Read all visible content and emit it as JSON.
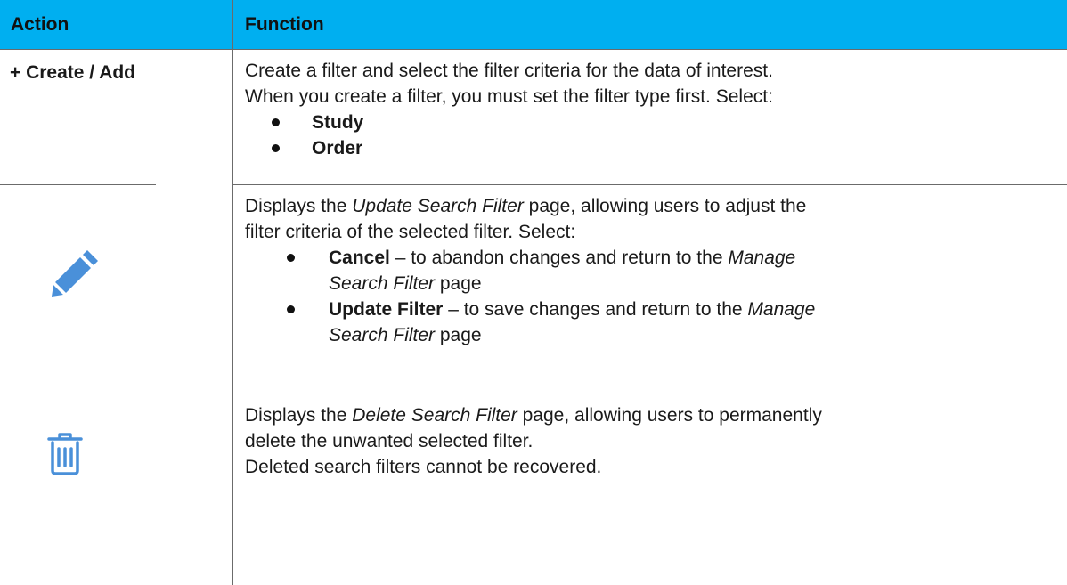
{
  "header": {
    "action_label": "Action",
    "function_label": "Function"
  },
  "rows": [
    {
      "action": "+ Create / Add",
      "lines": [
        "Create a filter and select the filter criteria for the data of interest.",
        "When you create a filter, you must set the filter type first.  Select:"
      ],
      "bullets": [
        "Study",
        "Order"
      ]
    },
    {
      "action_icon": "pencil-icon",
      "line1_prefix": "Displays the ",
      "line1_em": "Update Search Filter",
      "line1_suffix": " page, allowing users to adjust the",
      "line2": "filter criteria of the selected filter.  Select:",
      "bullets": [
        {
          "bold": "Cancel",
          "text1": " – to abandon changes and return to the ",
          "em1": "Manage",
          "em2": "Search Filter",
          "text2": " page"
        },
        {
          "bold": "Update Filter",
          "text1": " – to save changes and return to the ",
          "em1": "Manage",
          "em2": "Search Filter",
          "text2": " page"
        }
      ]
    },
    {
      "action_icon": "trash-icon",
      "line1_prefix": "Displays the ",
      "line1_em": "Delete Search Filter",
      "line1_suffix": " page, allowing users to permanently",
      "line2": "delete the unwanted selected filter.",
      "line3": "Deleted search filters cannot be recovered."
    }
  ],
  "colors": {
    "header_bg": "#00aff0",
    "icon": "#4a90d9",
    "rule": "#6b6b6b"
  }
}
